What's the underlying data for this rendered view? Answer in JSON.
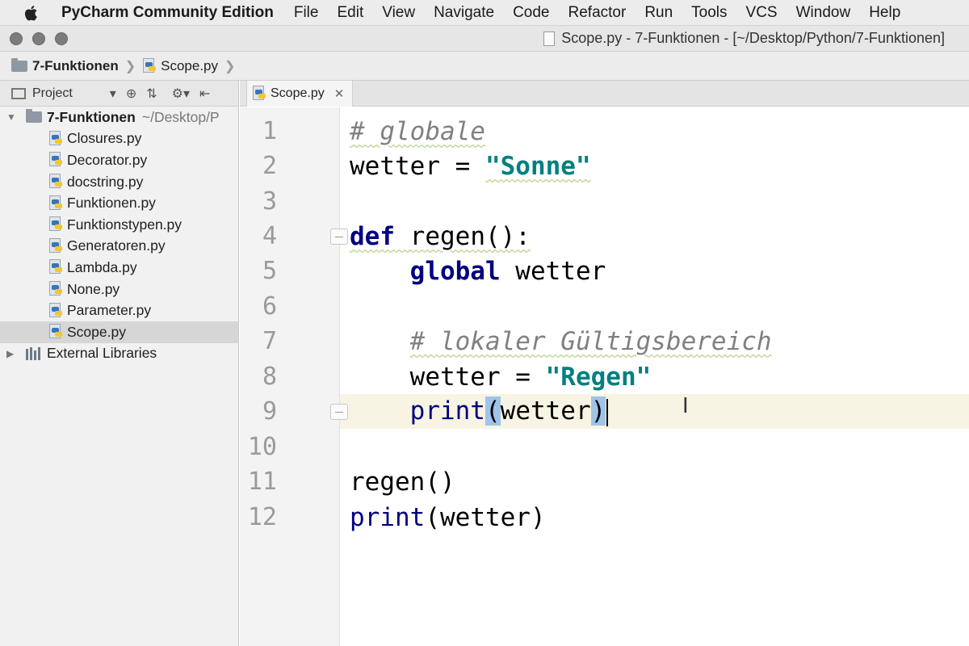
{
  "menubar": {
    "app_name": "PyCharm Community Edition",
    "items": [
      "File",
      "Edit",
      "View",
      "Navigate",
      "Code",
      "Refactor",
      "Run",
      "Tools",
      "VCS",
      "Window",
      "Help"
    ]
  },
  "window": {
    "title": "Scope.py - 7-Funktionen - [~/Desktop/Python/7-Funktionen]"
  },
  "breadcrumb": {
    "project": "7-Funktionen",
    "file": "Scope.py"
  },
  "project_panel": {
    "header_label": "Project",
    "root": {
      "name": "7-Funktionen",
      "path": "~/Desktop/P"
    },
    "files": [
      {
        "name": "Closures.py",
        "selected": false
      },
      {
        "name": "Decorator.py",
        "selected": false
      },
      {
        "name": "docstring.py",
        "selected": false
      },
      {
        "name": "Funktionen.py",
        "selected": false
      },
      {
        "name": "Funktionstypen.py",
        "selected": false
      },
      {
        "name": "Generatoren.py",
        "selected": false
      },
      {
        "name": "Lambda.py",
        "selected": false
      },
      {
        "name": "None.py",
        "selected": false
      },
      {
        "name": "Parameter.py",
        "selected": false
      },
      {
        "name": "Scope.py",
        "selected": true
      }
    ],
    "external_libraries": "External Libraries"
  },
  "editor": {
    "tab_label": "Scope.py",
    "line_numbers": [
      "1",
      "2",
      "3",
      "4",
      "5",
      "6",
      "7",
      "8",
      "9",
      "10",
      "11",
      "12"
    ],
    "current_line": "9",
    "code": {
      "l1_comment": "# globale",
      "l2_var": "wetter = ",
      "l2_str": "\"Sonne\"",
      "l4_kw": "def",
      "l4_rest": " regen():",
      "l5_kw": "global",
      "l5_rest": " wetter",
      "l7_comment": "# lokaler Gültigsbereich",
      "l8_var": "wetter = ",
      "l8_str": "\"Regen\"",
      "l9_fn": "print",
      "l9_open": "(",
      "l9_arg": "wetter",
      "l9_close": ")",
      "l11": "regen()",
      "l12_fn": "print",
      "l12_rest": "(wetter)"
    }
  },
  "colors": {
    "keyword": "#000080",
    "string": "#008080",
    "comment": "#808080",
    "current_line_bg": "#f7f4e3",
    "brace_highlight": "#9fc4e8"
  }
}
